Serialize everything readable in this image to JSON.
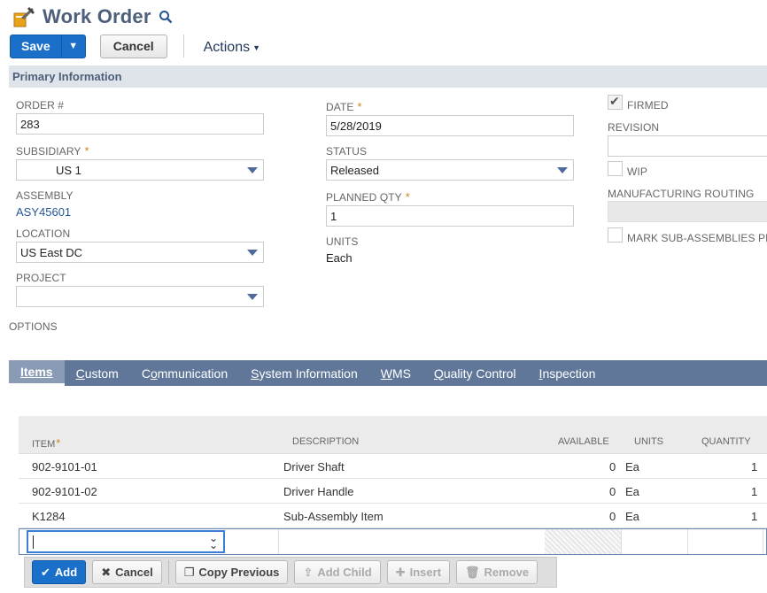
{
  "header": {
    "title": "Work Order"
  },
  "toolbar": {
    "save_label": "Save",
    "cancel_label": "Cancel",
    "actions_label": "Actions"
  },
  "primary": {
    "section_title": "Primary Information",
    "order_label": "ORDER #",
    "order_value": "283",
    "subsidiary_label": "SUBSIDIARY",
    "subsidiary_value": "US 1",
    "assembly_label": "ASSEMBLY",
    "assembly_value": "ASY45601",
    "location_label": "LOCATION",
    "location_value": "US East DC",
    "project_label": "PROJECT",
    "project_value": "",
    "options_label": "OPTIONS",
    "date_label": "DATE",
    "date_value": "5/28/2019",
    "status_label": "STATUS",
    "status_value": "Released",
    "planned_qty_label": "PLANNED QTY",
    "planned_qty_value": "1",
    "units_label": "UNITS",
    "units_value": "Each",
    "firmed_label": "FIRMED",
    "revision_label": "REVISION",
    "wip_label": "WIP",
    "routing_label": "MANUFACTURING ROUTING",
    "mark_sub_label": "MARK SUB-ASSEMBLIES PHA"
  },
  "tabs": [
    {
      "pre": "",
      "ul": "Items",
      "post": ""
    },
    {
      "pre": "",
      "ul": "C",
      "post": "ustom"
    },
    {
      "pre": "C",
      "ul": "o",
      "post": "mmunication"
    },
    {
      "pre": "",
      "ul": "S",
      "post": "ystem Information"
    },
    {
      "pre": "",
      "ul": "W",
      "post": "MS"
    },
    {
      "pre": "",
      "ul": "Q",
      "post": "uality Control"
    },
    {
      "pre": "",
      "ul": "I",
      "post": "nspection"
    }
  ],
  "grid": {
    "headers": {
      "item": "ITEM",
      "description": "DESCRIPTION",
      "available": "AVAILABLE",
      "units": "UNITS",
      "quantity": "QUANTITY"
    },
    "rows": [
      {
        "item": "902-9101-01",
        "description": "Driver Shaft",
        "available": "0",
        "units": "Ea",
        "quantity": "1"
      },
      {
        "item": "902-9101-02",
        "description": "Driver Handle",
        "available": "0",
        "units": "Ea",
        "quantity": "1"
      },
      {
        "item": "K1284",
        "description": "Sub-Assembly Item",
        "available": "0",
        "units": "Ea",
        "quantity": "1"
      }
    ]
  },
  "row_actions": {
    "add": "Add",
    "cancel": "Cancel",
    "copy_previous": "Copy Previous",
    "add_child": "Add Child",
    "insert": "Insert",
    "remove": "Remove"
  },
  "colors": {
    "accent": "#1a6fc8",
    "tab_bar": "#607799",
    "section_header": "#dfe4eb",
    "required": "#c9861c"
  }
}
